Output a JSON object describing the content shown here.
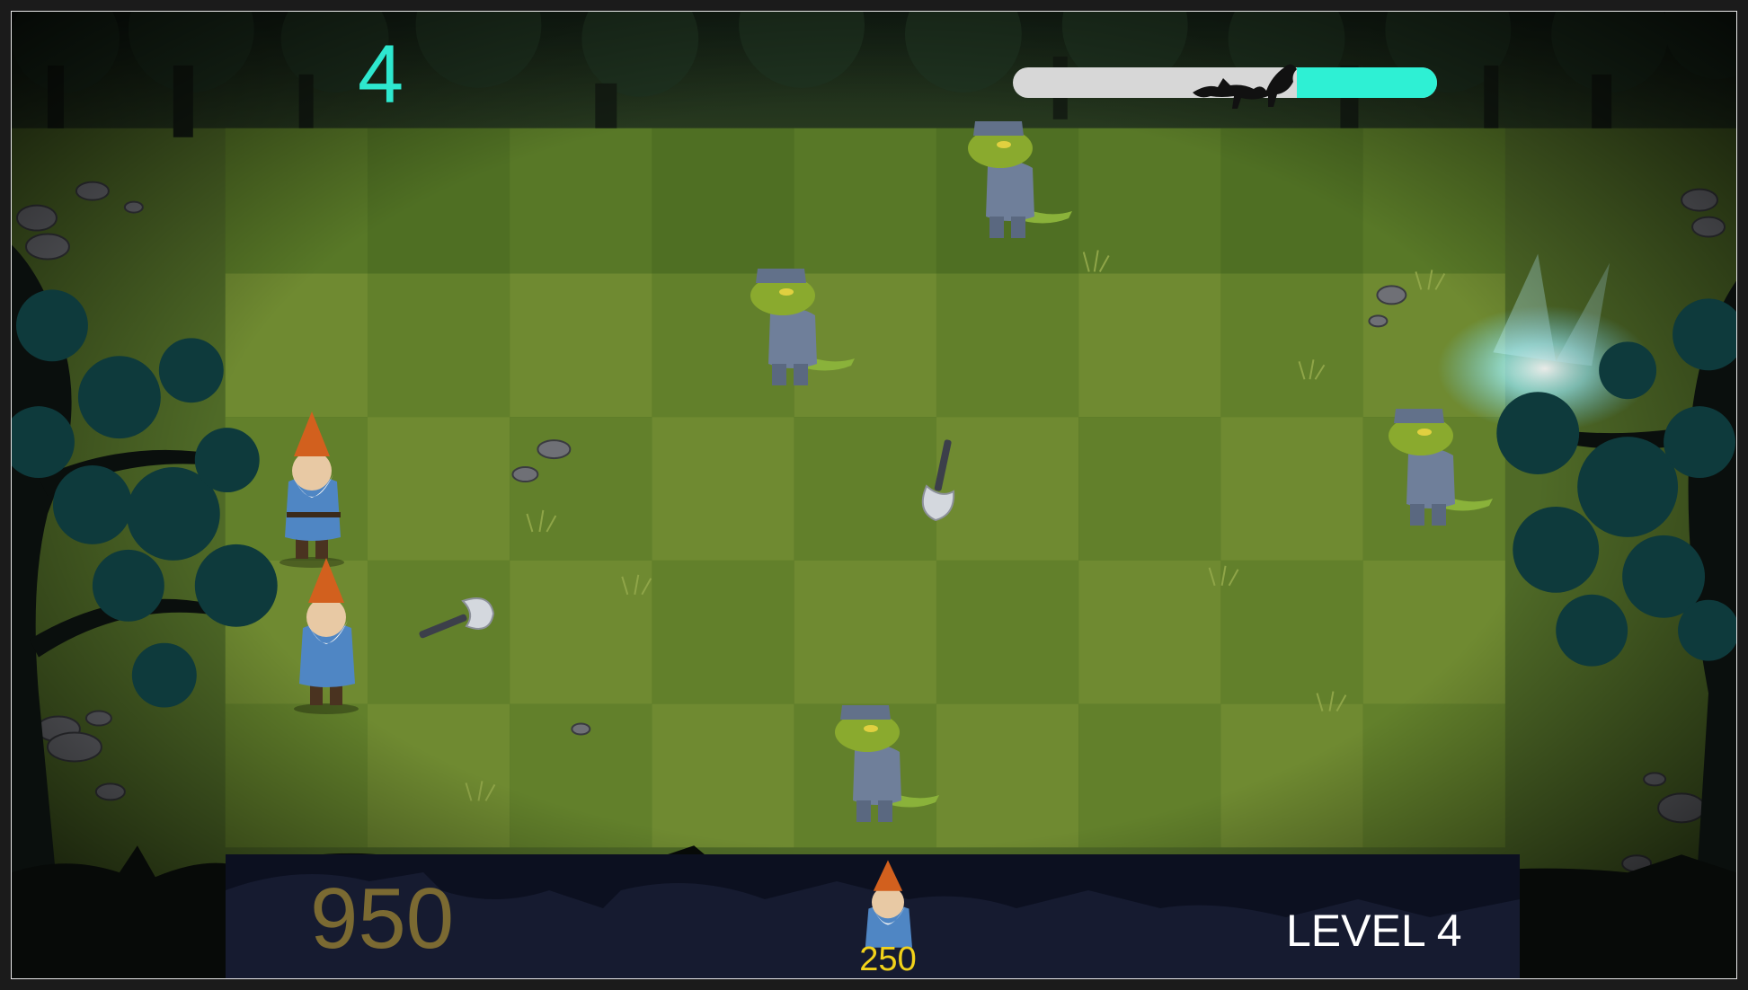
{
  "hud": {
    "wave": "4",
    "progress_fill": 0.33,
    "wave_icon": "wolf-silhouette-icon"
  },
  "bottom": {
    "gold": "950",
    "level": "LEVEL 4",
    "shop_gnome_cost": "250"
  },
  "colors": {
    "accent": "#2ef0d4",
    "gold": "#7b6a32",
    "cost": "#f2d21a",
    "grass": "#5d7a2c"
  },
  "board": {
    "cols": 9,
    "rows": 4
  },
  "entities": {
    "gnomes": [
      {
        "name": "gnome-defender"
      },
      {
        "name": "gnome-defender"
      }
    ],
    "lizards": [
      {
        "name": "lizard-soldier"
      },
      {
        "name": "lizard-soldier"
      },
      {
        "name": "lizard-soldier"
      },
      {
        "name": "lizard-soldier"
      }
    ],
    "axes": [
      {
        "name": "thrown-axe"
      },
      {
        "name": "thrown-axe"
      }
    ]
  }
}
